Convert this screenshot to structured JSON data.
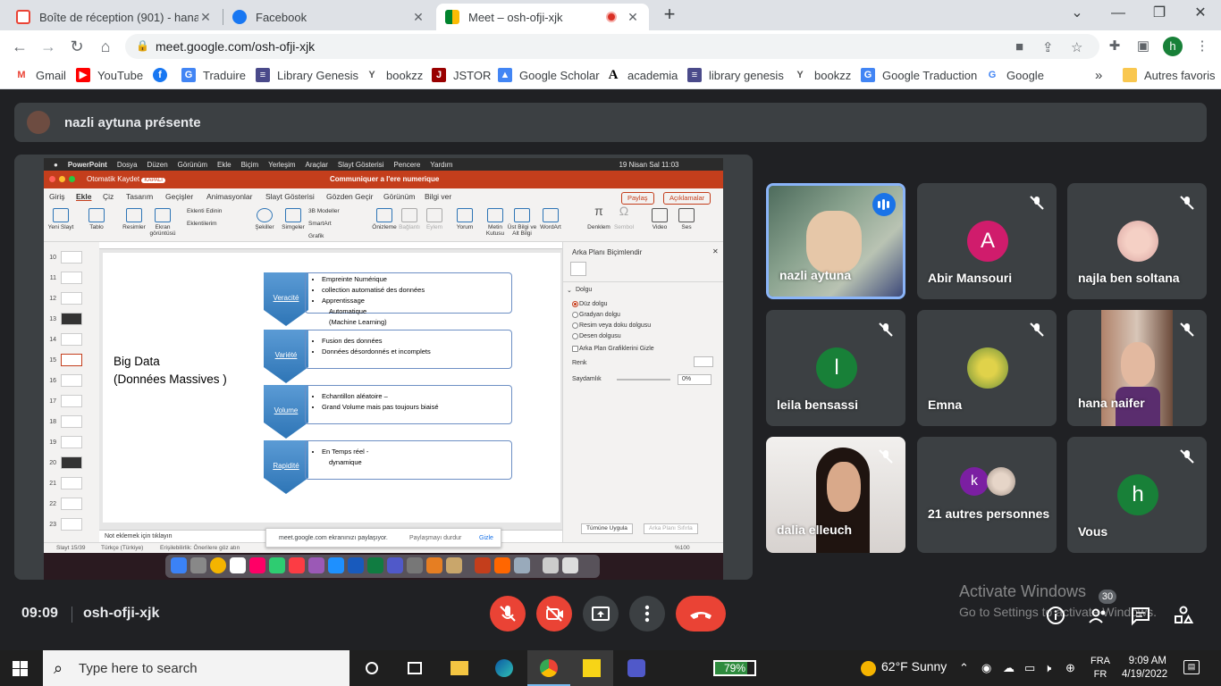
{
  "browser": {
    "tabs": [
      {
        "title": "Boîte de réception (901) - hana.n",
        "close": "✕"
      },
      {
        "title": "Facebook",
        "close": "✕"
      },
      {
        "title": "Meet – osh-ofji-xjk",
        "close": "✕"
      }
    ],
    "new_tab": "+",
    "url": "meet.google.com/osh-ofji-xjk",
    "profile_initial": "h",
    "bookmarks": [
      "Gmail",
      "YouTube",
      "Traduire",
      "Library Genesis",
      "bookzz",
      "JSTOR",
      "Google Scholar",
      "academia",
      "library genesis",
      "bookzz",
      "Google Traduction",
      "Google"
    ],
    "bookmarks_more": "»",
    "other_bookmarks": "Autres favoris"
  },
  "meet": {
    "presenter_text": "nazli aytuna présente",
    "time": "09:09",
    "meeting_code": "osh-ofji-xjk",
    "participant_count": "30",
    "watermark_title": "Activate Windows",
    "watermark_sub": "Go to Settings to activate Windows.",
    "participants": [
      {
        "name": "nazli aytuna"
      },
      {
        "name": "Abir Mansouri",
        "initial": "A"
      },
      {
        "name": "najla ben soltana"
      },
      {
        "name": "leila bensassi",
        "initial": "l"
      },
      {
        "name": "Emna"
      },
      {
        "name": "hana naifer"
      },
      {
        "name": "dalia elleuch"
      },
      {
        "name": "21 autres personnes",
        "initial": "k"
      },
      {
        "name": "Vous",
        "initial": "h"
      }
    ]
  },
  "shared": {
    "mac_menu": [
      "PowerPoint",
      "Dosya",
      "Düzen",
      "Görünüm",
      "Ekle",
      "Biçim",
      "Yerleşim",
      "Araçlar",
      "Slayt Gösterisi",
      "Pencere",
      "Yardım"
    ],
    "mac_clock": "19 Nisan Sal  11:03",
    "autosave": "Otomatik Kaydet",
    "autosave_state": "KAPALI",
    "doc_title": "Communiquer a l'ere numerique",
    "ribbon_tabs": [
      "Giriş",
      "Ekle",
      "Çiz",
      "Tasarım",
      "Geçişler",
      "Animasyonlar",
      "Slayt Gösterisi",
      "Gözden Geçir",
      "Görünüm",
      "Bilgi ver"
    ],
    "share_label": "Paylaş",
    "comments_label": "Açıklamalar",
    "ribbon_buttons": [
      "Yeni Slayt",
      "Tablo",
      "Resimler",
      "Ekran görüntüsü",
      "Eklenti Edinin",
      "Eklentilerim",
      "Şekiller",
      "Simgeler",
      "3B Modeller",
      "SmartArt",
      "Grafik",
      "Önizleme",
      "Bağlantı",
      "Eylem",
      "Yorum",
      "Metin Kutusu",
      "Üst Bilgi ve Alt Bilgi",
      "WordArt",
      "Denklem",
      "Sembol",
      "Video",
      "Ses"
    ],
    "thumb_numbers": [
      "10",
      "11",
      "12",
      "13",
      "14",
      "15",
      "16",
      "17",
      "18",
      "19",
      "20",
      "21",
      "22",
      "23"
    ],
    "slide": {
      "left_title_1": "Big Data",
      "left_title_2": "(Données Massives )",
      "rows": [
        {
          "label": "Veracité",
          "items": [
            "Empreinte Numérique",
            "collection  automatisé des données",
            "Apprentissage",
            "Automatique",
            "(Machine Learning)"
          ]
        },
        {
          "label": "Variété",
          "items": [
            "Fusion des données",
            "Données désordonnés et incomplets"
          ]
        },
        {
          "label": "Volume",
          "items": [
            "Echantillon aléatoire –",
            "Grand Volume  mais pas toujours biaisé"
          ]
        },
        {
          "label": "Rapidité",
          "items": [
            "En Temps réel -",
            "dynamique"
          ]
        }
      ]
    },
    "notes": "Not eklemek için tıklayın",
    "pane": {
      "title": "Arka Planı Biçimlendir",
      "section": "Dolgu",
      "options": [
        "Düz dolgu",
        "Gradyan dolgu",
        "Resim veya doku dolgusu",
        "Desen dolgusu"
      ],
      "hide": "Arka Plan Grafiklerini Gizle",
      "color": "Renk",
      "transparency": "Saydamlık",
      "transparency_value": "0%",
      "apply_all": "Tümüne Uygula",
      "reset": "Arka Planı Sıfırla"
    },
    "status": {
      "slide": "Slayt 15/39",
      "lang": "Türkçe (Türkiye)",
      "access": "Erişilebilirlik: Önerilere göz atın",
      "zoom": "%100"
    },
    "share_popup": {
      "text": "meet.google.com ekranınızı paylaşıyor.",
      "stop": "Paylaşmayı durdur",
      "hide": "Gizle"
    }
  },
  "taskbar": {
    "search_placeholder": "Type here to search",
    "battery": "79%",
    "weather": "62°F  Sunny",
    "lang1": "FRA",
    "lang2": "FR",
    "time": "9:09 AM",
    "date": "4/19/2022"
  }
}
